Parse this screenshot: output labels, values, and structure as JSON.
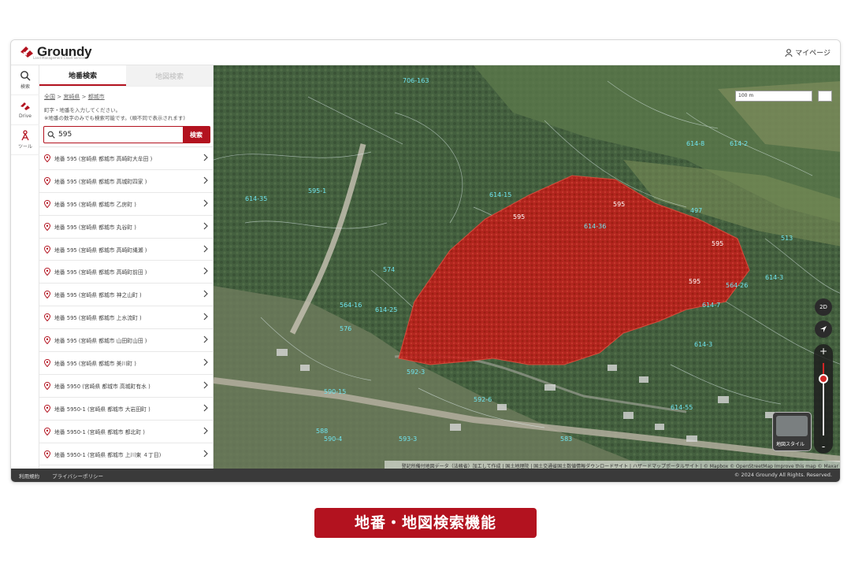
{
  "app": {
    "logo_text": "Groundy",
    "logo_tagline": "Land Management Cloud Service",
    "mypage_label": "マイページ"
  },
  "rail": [
    {
      "icon": "search-icon",
      "label": "検索"
    },
    {
      "icon": "drive-icon",
      "label": "Drive"
    },
    {
      "icon": "tool-icon",
      "label": "ツール"
    }
  ],
  "panel": {
    "tab_active": "地番検索",
    "tab_inactive": "地図検索",
    "breadcrumb": [
      "全国",
      "宮崎県",
      "都城市"
    ],
    "breadcrumb_sep": ">",
    "hint_line1": "町字・地番を入力してください。",
    "hint_line2": "※地番の数字のみでも検索可能です。(順不同で表示されます)",
    "search_value": "595",
    "search_button": "検索",
    "results": [
      "地番 595 (宮崎県 都城市 高崎町大牟田 )",
      "地番 595 (宮崎県 都城市 高城町四家 )",
      "地番 595 (宮崎県 都城市 乙房町 )",
      "地番 595 (宮崎県 都城市 丸谷町 )",
      "地番 595 (宮崎県 都城市 高崎町縄瀬 )",
      "地番 595 (宮崎県 都城市 高崎町前田 )",
      "地番 595 (宮崎県 都城市 神之山町 )",
      "地番 595 (宮崎県 都城市 上水流町 )",
      "地番 595 (宮崎県 都城市 山田町山田 )",
      "地番 595 (宮崎県 都城市 美川町 )",
      "地番 5950 (宮崎県 都城市 高城町有水 )",
      "地番 5950-1 (宮崎県 都城市 大岩田町 )",
      "地番 5950-1 (宮崎県 都城市 都北町 )",
      "地番 5950-1 (宮崎県 都城市 上川東 ４丁目)"
    ]
  },
  "footer": {
    "links": [
      "利用規約",
      "プライバシーポリシー"
    ],
    "copyright": "© 2024 Groundy All Rights. Reserved."
  },
  "map": {
    "scale_label": "100 m",
    "btn_2d": "2D",
    "zoom_plus": "+",
    "zoom_minus": "-",
    "zoom_level_fraction": 0.2,
    "map_style_label": "地図スタイル",
    "attribution": "登記所備付地図データ（法務省）加工して作成 | 国土地理院 | 国土交通省国土数値情報ダウンロードサイト | ハザードマップポータルサイト | © Mapbox © OpenStreetMap Improve this map © Maxar",
    "highlight_labels": [
      "595",
      "595",
      "595",
      "595"
    ],
    "parcel_labels": [
      "706-163",
      "614-2",
      "614-15",
      "614-35",
      "614-36",
      "595-1",
      "564-16",
      "614-25",
      "592-3",
      "590-15",
      "592-6",
      "588",
      "590-4",
      "593-3",
      "614-7",
      "614-3",
      "614-55",
      "583",
      "576",
      "574",
      "614-3",
      "614-8",
      "497",
      "513",
      "564-26"
    ],
    "highlight_color": "#c0201c",
    "accent_color": "#b3121f"
  },
  "caption": "地番・地図検索機能"
}
